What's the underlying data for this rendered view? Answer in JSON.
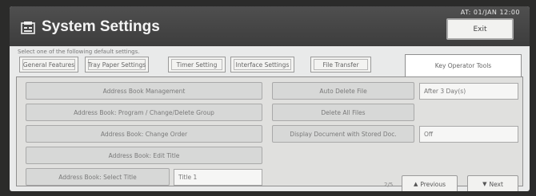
{
  "status_bar": "AT: 01/JAN 12:00",
  "title": "System Settings",
  "exit_label": "Exit",
  "instruction": "Select one of the following default settings.",
  "tabs": [
    {
      "label": "General Features"
    },
    {
      "label": "Tray Paper Settings"
    },
    {
      "label": "Timer Setting"
    },
    {
      "label": "Interface Settings"
    },
    {
      "label": "File Transfer"
    },
    {
      "label": "Key Operator Tools"
    }
  ],
  "left_buttons": [
    {
      "label": "Address Book Management"
    },
    {
      "label": "Address Book: Program / Change/Delete Group"
    },
    {
      "label": "Address Book: Change Order"
    },
    {
      "label": "Address Book: Edit Title"
    },
    {
      "label": "Address Book: Select Title"
    }
  ],
  "select_title_value": "Title 1",
  "right_buttons": [
    {
      "label": "Auto Delete File",
      "value": "After 3 Day(s)"
    },
    {
      "label": "Delete All Files",
      "value": ""
    },
    {
      "label": "Display Document with Stored Doc.",
      "value": "Off"
    }
  ],
  "page_indicator": "2/5",
  "previous_label": "Previous",
  "next_label": "Next"
}
